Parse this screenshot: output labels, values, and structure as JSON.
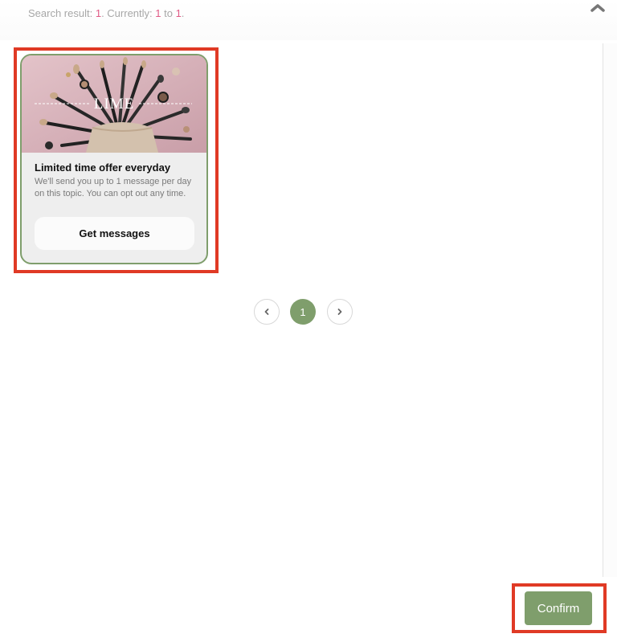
{
  "header": {
    "search_prefix": "Search result: ",
    "result_count": "1",
    "currently_label": ". Currently: ",
    "range_start": "1",
    "range_to": " to ",
    "range_end": "1",
    "range_suffix": ".",
    "collapse_icon": "chevron-up-icon"
  },
  "card": {
    "image_alt_icon": "makeup-brushes-image",
    "logo_text": "LIME",
    "title": "Limited time offer everyday",
    "description": "We'll send you up to 1 message per day on this topic. You can opt out any time.",
    "button_label": "Get messages"
  },
  "pagination": {
    "prev_icon": "chevron-left-icon",
    "current_page": "1",
    "next_icon": "chevron-right-icon"
  },
  "footer": {
    "confirm_label": "Confirm"
  },
  "colors": {
    "accent": "#7f9e6c",
    "highlight": "#e03a25",
    "count_pink": "#e05a86"
  }
}
